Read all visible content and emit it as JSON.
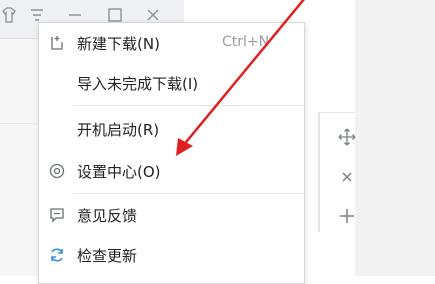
{
  "titlebar": {
    "buttons": [
      "shirt-icon",
      "menu-icon",
      "minimize-icon",
      "maximize-icon",
      "close-icon"
    ]
  },
  "menu": {
    "items": [
      {
        "label": "新建下载(N)",
        "shortcut": "Ctrl+N",
        "icon": "new-download-icon"
      },
      {
        "label": "导入未完成下载(I)",
        "shortcut": "",
        "icon": ""
      },
      {
        "label": "开机启动(R)",
        "shortcut": "",
        "icon": ""
      },
      {
        "label": "设置中心(O)",
        "shortcut": "",
        "icon": "gear-icon"
      },
      {
        "label": "意见反馈",
        "shortcut": "",
        "icon": "feedback-icon"
      },
      {
        "label": "检查更新",
        "shortcut": "",
        "icon": "refresh-icon"
      }
    ]
  },
  "side_controls": [
    "move-icon",
    "close-icon",
    "add-icon"
  ],
  "colors": {
    "arrow": "#e02020",
    "menu_border": "#d5d8dc",
    "refresh_icon": "#2f8de4"
  }
}
